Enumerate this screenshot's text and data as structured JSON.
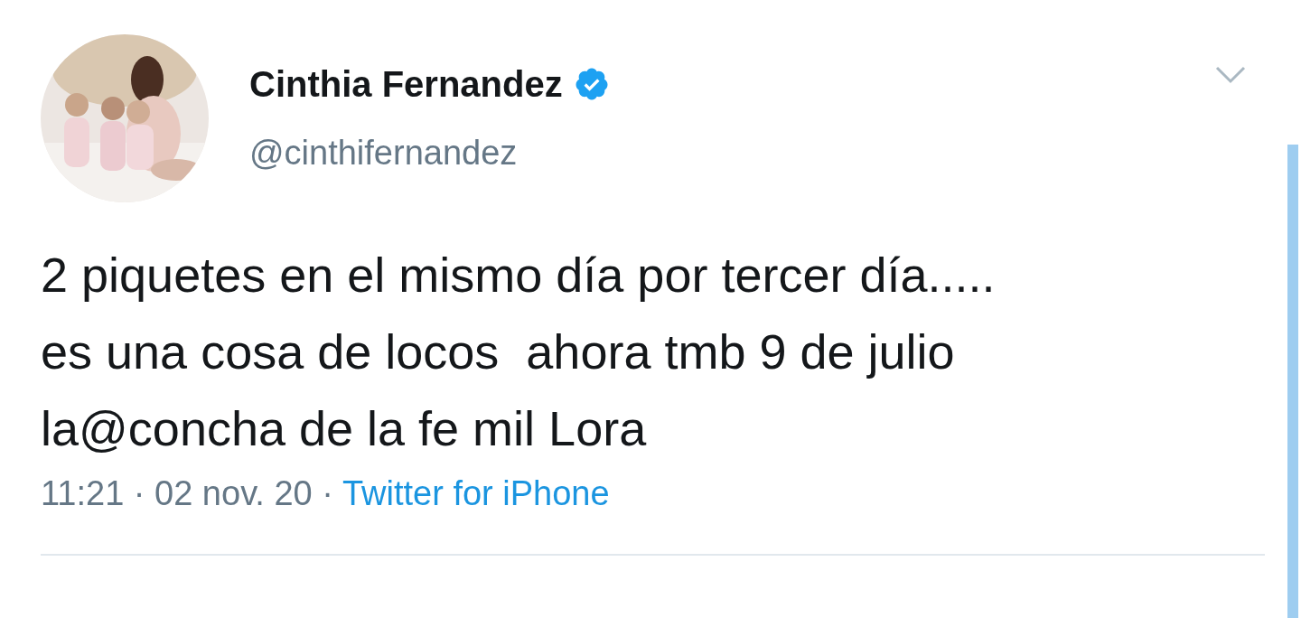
{
  "tweet": {
    "author": {
      "name": "Cinthia Fernandez",
      "verified": true,
      "handle": "@cinthifernandez"
    },
    "text_lines": [
      "2 piquetes en el mismo día por tercer día.....",
      "es una cosa de locos  ahora tmb 9 de julio",
      "la@concha de la fe mil Lora"
    ],
    "timestamp": "11:21 · 02 nov. 20 ·",
    "source": "Twitter for iPhone"
  }
}
